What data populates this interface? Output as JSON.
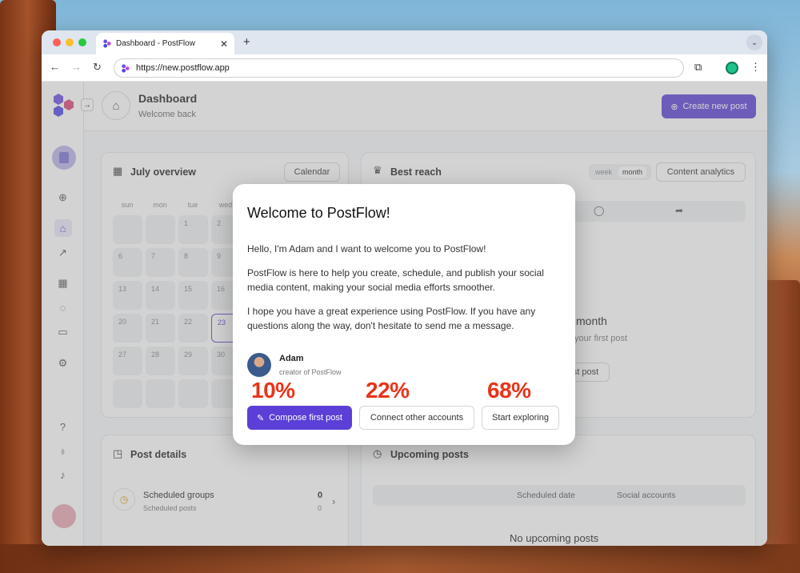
{
  "browser": {
    "tab_title": "Dashboard - PostFlow",
    "new_tab_symbol": "+",
    "url": "https://new.postflow.app"
  },
  "header": {
    "title": "Dashboard",
    "subtitle": "Welcome back",
    "create_button": "Create new post"
  },
  "overview": {
    "title": "July overview",
    "calendar_button": "Calendar",
    "weekdays": [
      "sun",
      "mon",
      "tue",
      "wed"
    ],
    "rows": [
      [
        "",
        "",
        "1",
        "2"
      ],
      [
        "6",
        "7",
        "8",
        "9"
      ],
      [
        "13",
        "14",
        "15",
        "16"
      ],
      [
        "20",
        "21",
        "22",
        "23"
      ],
      [
        "27",
        "28",
        "29",
        "30"
      ],
      [
        "",
        "",
        "",
        ""
      ]
    ]
  },
  "best_reach": {
    "title": "Best reach",
    "toggle_week": "week",
    "toggle_month": "month",
    "analytics_button": "Content analytics",
    "empty_title_partial": "month",
    "empty_sub_partial": "your first post",
    "empty_button_partial": "st post"
  },
  "post_details": {
    "title": "Post details",
    "row_title": "Scheduled groups",
    "row_sub": "Scheduled posts",
    "row_count": "0",
    "row_count_sub": "0"
  },
  "upcoming": {
    "title": "Upcoming posts",
    "col_date": "Scheduled date",
    "col_accounts": "Social accounts",
    "empty": "No upcoming posts"
  },
  "modal": {
    "title": "Welcome to PostFlow!",
    "p1": "Hello, I'm Adam and I want to welcome you to PostFlow!",
    "p2": "PostFlow is here to help you create, schedule, and publish your social media content, making your social media efforts smoother.",
    "p3": "I hope you have a great experience using PostFlow. If you have any questions along the way, don't hesitate to send me a message.",
    "author_name": "Adam",
    "author_role": "creator of PostFlow",
    "pct1": "10%",
    "pct2": "22%",
    "pct3": "68%",
    "btn_compose": "Compose first post",
    "btn_connect": "Connect other accounts",
    "btn_explore": "Start exploring"
  },
  "colors": {
    "accent": "#5b3fd6",
    "percent": "#e8341a"
  }
}
